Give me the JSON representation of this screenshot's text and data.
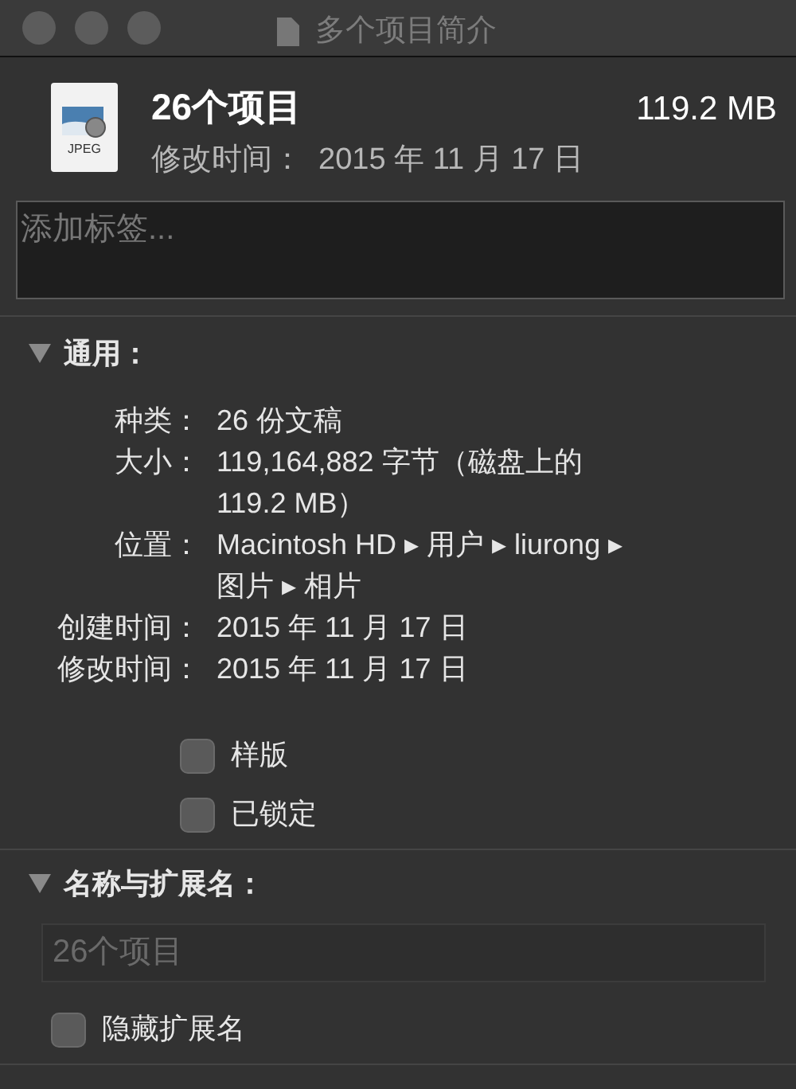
{
  "window": {
    "title": "多个项目简介"
  },
  "header": {
    "name": "26个项目",
    "size": "119.2 MB",
    "modified_label": "修改时间：",
    "modified": "2015 年 11 月 17 日",
    "icon_label": "JPEG"
  },
  "tags": {
    "placeholder": "添加标签..."
  },
  "general": {
    "title": "通用：",
    "expanded": true,
    "rows": [
      {
        "label": "种类：",
        "value": "26 份文稿"
      },
      {
        "label": "大小：",
        "value": [
          "119,164,882 字节（磁盘上的",
          "119.2 MB）"
        ]
      },
      {
        "label": "位置：",
        "value": [
          "Macintosh HD ▸ 用户 ▸ liurong ▸",
          "图片 ▸ 相片"
        ]
      },
      {
        "label": "创建时间：",
        "value": "2015 年 11 月 17 日"
      },
      {
        "label": "修改时间：",
        "value": "2015 年 11 月 17 日"
      }
    ],
    "checkboxes": [
      {
        "label": "样版",
        "checked": false
      },
      {
        "label": "已锁定",
        "checked": false
      }
    ]
  },
  "name_extension": {
    "title": "名称与扩展名：",
    "expanded": true,
    "placeholder": "26个项目",
    "checkboxes": [
      {
        "label": "隐藏扩展名",
        "checked": false
      }
    ]
  }
}
